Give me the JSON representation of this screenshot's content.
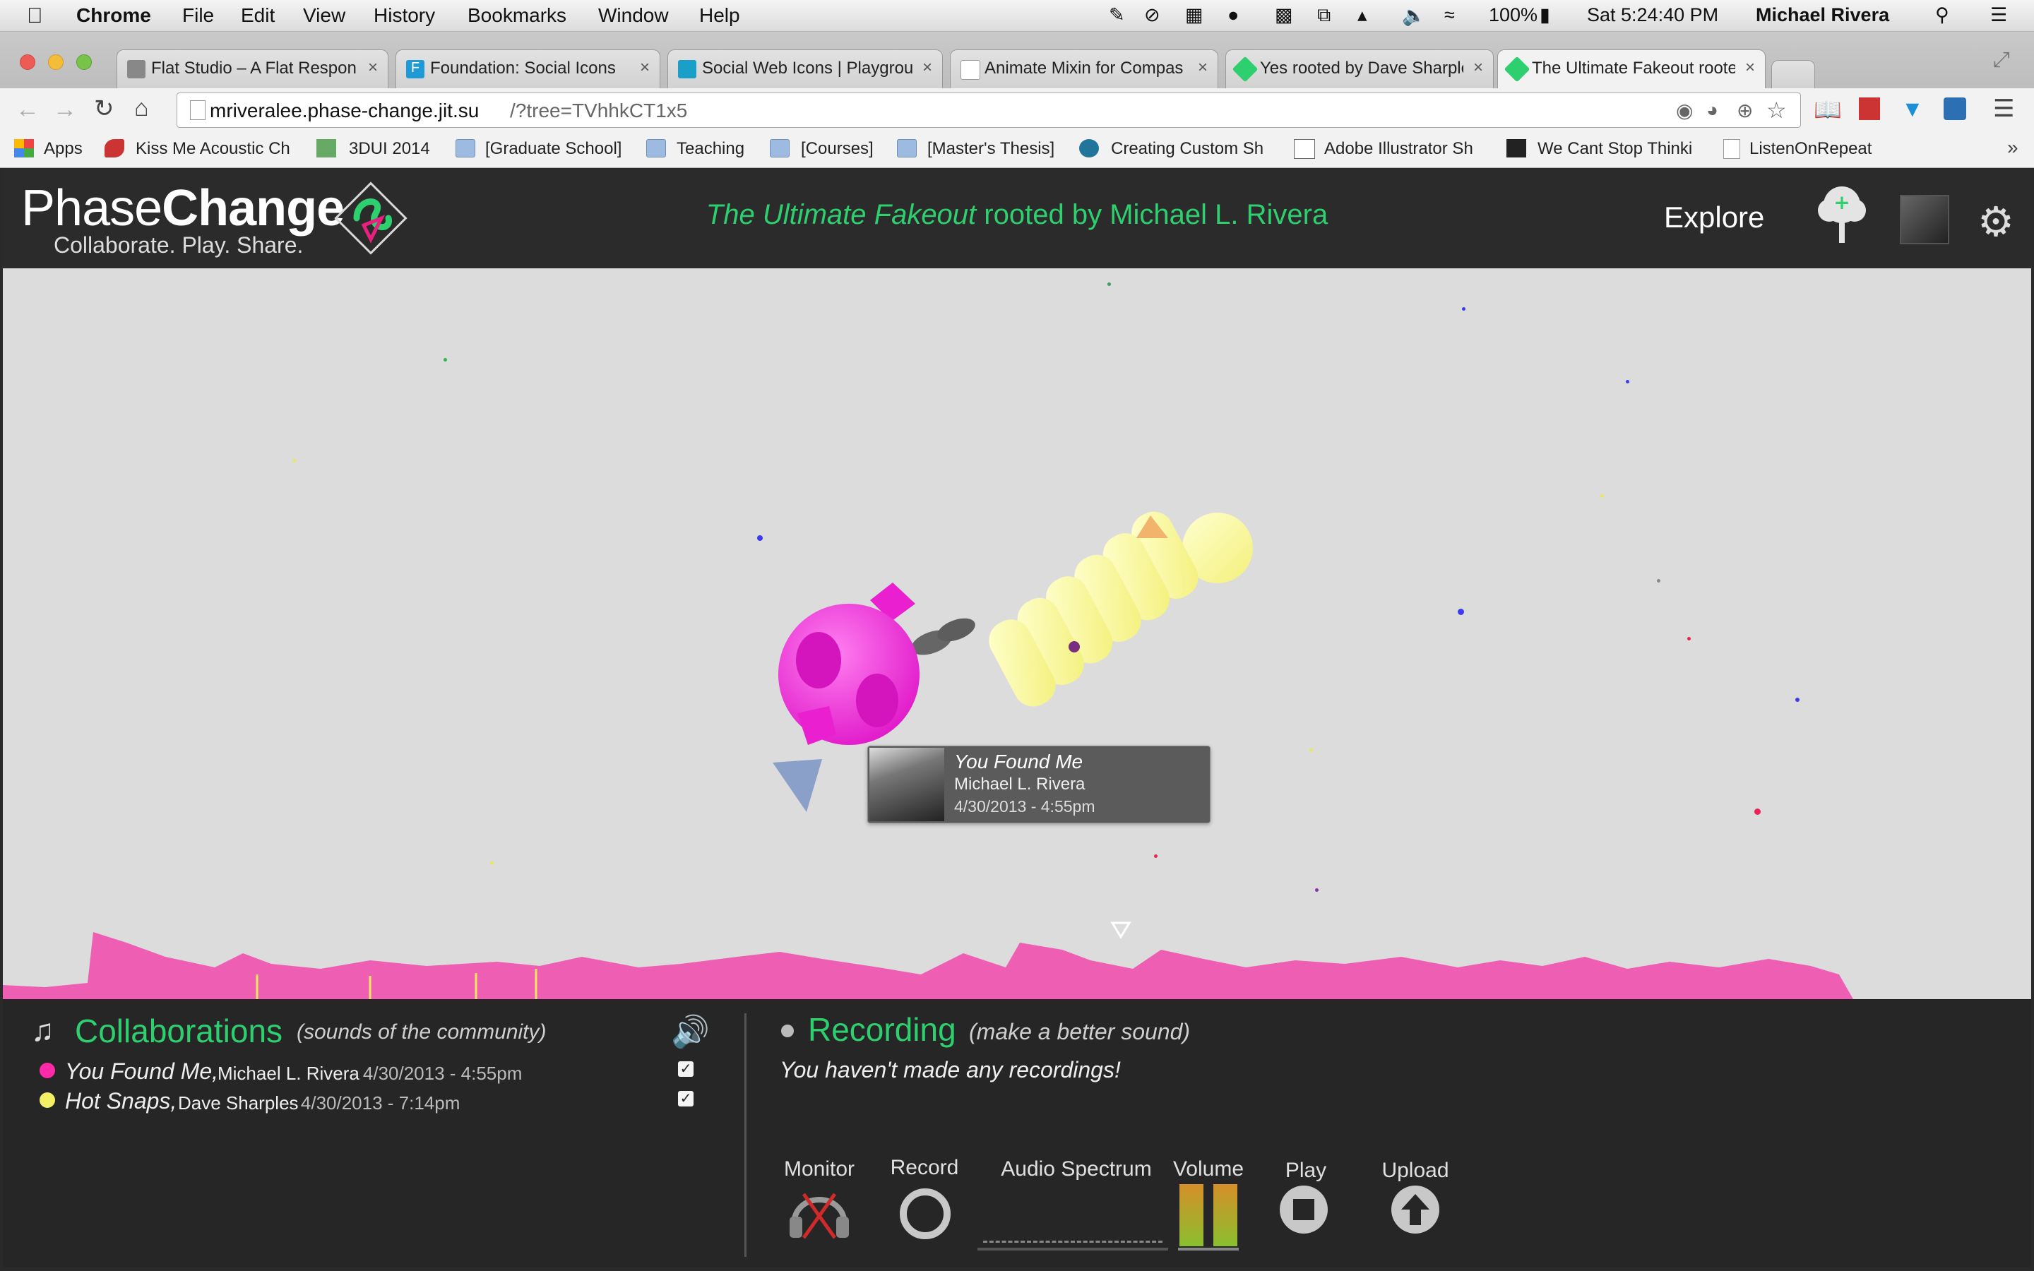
{
  "menubar": {
    "app": "Chrome",
    "items": [
      "File",
      "Edit",
      "View",
      "History",
      "Bookmarks",
      "Window",
      "Help"
    ],
    "battery": "100%",
    "clock": "Sat 5:24:40 PM",
    "user": "Michael Rivera"
  },
  "tabs": [
    {
      "label": "Flat Studio – A Flat Respon"
    },
    {
      "label": "Foundation: Social Icons"
    },
    {
      "label": "Social Web Icons | Playgrou"
    },
    {
      "label": "Animate Mixin for Compas"
    },
    {
      "label": "Yes rooted by Dave Sharple"
    },
    {
      "label": "The Ultimate Fakeout roote"
    }
  ],
  "address": {
    "host": "mriveralee.phase-change.jit.su",
    "path": "/?tree=TVhhkCT1x5"
  },
  "bookmarks": [
    {
      "label": "Apps"
    },
    {
      "label": "Kiss Me Acoustic Ch"
    },
    {
      "label": "3DUI 2014"
    },
    {
      "label": "[Graduate School]"
    },
    {
      "label": "Teaching"
    },
    {
      "label": "[Courses]"
    },
    {
      "label": "[Master's Thesis]"
    },
    {
      "label": "Creating Custom Sh"
    },
    {
      "label": "Adobe Illustrator Sh"
    },
    {
      "label": "We Cant Stop Thinki"
    },
    {
      "label": "ListenOnRepeat"
    }
  ],
  "header": {
    "brand_light": "Phase",
    "brand_bold": "Change",
    "tagline": "Collaborate. Play. Share.",
    "tree_title": "The Ultimate Fakeout",
    "rooted_by": "rooted by Michael L. Rivera",
    "explore": "Explore"
  },
  "tooltip": {
    "title": "You Found Me",
    "author": "Michael L. Rivera",
    "date": "4/30/2013 - 4:55pm"
  },
  "collaborations": {
    "title": "Collaborations",
    "subtitle": "(sounds of the community)",
    "items": [
      {
        "title": "You Found Me,",
        "author": "Michael L. Rivera",
        "date": "- 4/30/2013 - 4:55pm",
        "color": "#ff2aa8",
        "checked": true
      },
      {
        "title": "Hot Snaps,",
        "author": "Dave Sharples",
        "date": "- 4/30/2013 - 7:14pm",
        "color": "#f4f066",
        "checked": true
      }
    ]
  },
  "recording": {
    "title": "Recording",
    "subtitle": "(make a better sound)",
    "empty": "You haven't made any recordings!",
    "controls": {
      "monitor": "Monitor",
      "record": "Record",
      "spectrum": "Audio Spectrum",
      "volume": "Volume",
      "play": "Play",
      "upload": "Upload"
    }
  },
  "colors": {
    "accent_green": "#2ecf6e",
    "pink": "#ff33d6",
    "pale_yellow": "#ffff9e",
    "waveform": "#ee5fb4"
  }
}
